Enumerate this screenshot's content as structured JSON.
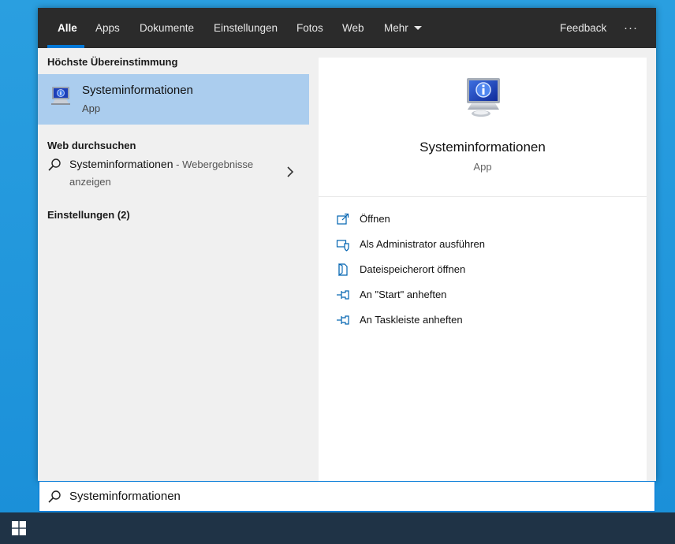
{
  "tabs": [
    {
      "label": "Alle"
    },
    {
      "label": "Apps"
    },
    {
      "label": "Dokumente"
    },
    {
      "label": "Einstellungen"
    },
    {
      "label": "Fotos"
    },
    {
      "label": "Web"
    },
    {
      "label": "Mehr"
    }
  ],
  "topbar": {
    "feedback": "Feedback",
    "more": "···"
  },
  "left": {
    "best_match_heading": "Höchste Übereinstimmung",
    "best_match": {
      "title": "Systeminformationen",
      "subtitle": "App"
    },
    "web_heading": "Web durchsuchen",
    "web_result": {
      "query": "Systeminformationen",
      "suffix": " - Webergebnisse",
      "line2": "anzeigen"
    },
    "settings_heading": "Einstellungen (2)"
  },
  "preview": {
    "title": "Systeminformationen",
    "subtitle": "App",
    "actions": [
      {
        "label": "Öffnen",
        "icon": "open-icon"
      },
      {
        "label": "Als Administrator ausführen",
        "icon": "shield-icon"
      },
      {
        "label": "Dateispeicherort öffnen",
        "icon": "file-location-icon"
      },
      {
        "label": "An \"Start\" anheften",
        "icon": "pin-icon"
      },
      {
        "label": "An Taskleiste anheften",
        "icon": "pin-icon"
      }
    ]
  },
  "search": {
    "value": "Systeminformationen"
  },
  "colors": {
    "accent": "#0078d7",
    "selection": "#abcdee",
    "topbar": "#2b2b2b",
    "taskbar": "#1f3346"
  }
}
